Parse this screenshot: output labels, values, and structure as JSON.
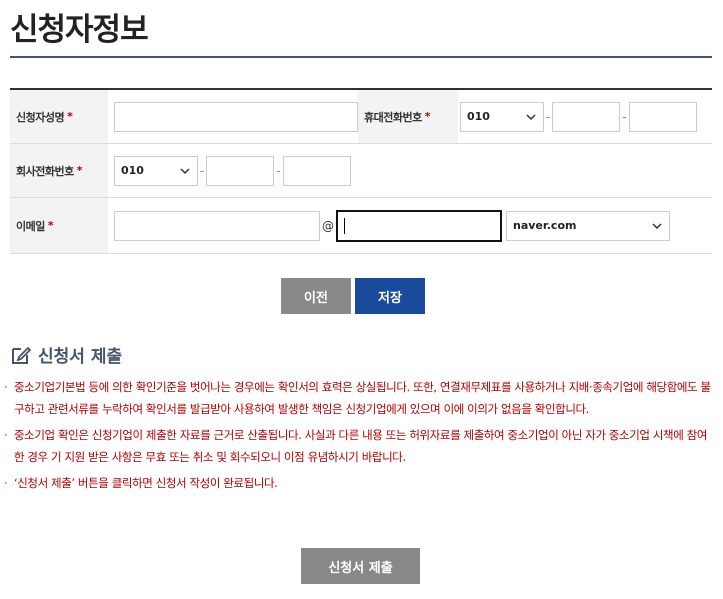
{
  "page": {
    "title": "신청자정보"
  },
  "form": {
    "name_label": "신청자성명",
    "mobile_label": "휴대전화번호",
    "company_phone_label": "회사전화번호",
    "email_label": "이메일",
    "required_mark": "*",
    "mobile_prefix": "010",
    "company_prefix": "010",
    "at_sign": "@",
    "dash": "-",
    "email_domain": "naver.com"
  },
  "buttons": {
    "prev": "이전",
    "save": "저장",
    "submit": "신청서 제출"
  },
  "section": {
    "title": "신청서 제출",
    "notes": [
      "중소기업기본법 등에 의한 확인기준을 벗어나는 경우에는 확인서의 효력은 상실됩니다. 또한, 연결재무제표를 사용하거나 지배·종속기업에 해당함에도 불구하고 관련서류를 누락하여 확인서를 발급받아 사용하여 발생한 책임은 신청기업에게 있으며 이에 이의가 없음을 확인합니다.",
      "중소기업 확인은 신청기업이 제출한 자료를 근거로 산출됩니다. 사실과 다른 내용 또는 허위자료를 제출하여 중소기업이 아닌 자가 중소기업 시책에 참여한 경우 기 지원 받은 사항은 무효 또는 취소 및 회수되오니 이점 유념하시기 바랍니다.",
      "‘신청서 제출’ 버튼을 클릭하면 신청서 작성이 완료됩니다."
    ],
    "bullet": "·"
  }
}
